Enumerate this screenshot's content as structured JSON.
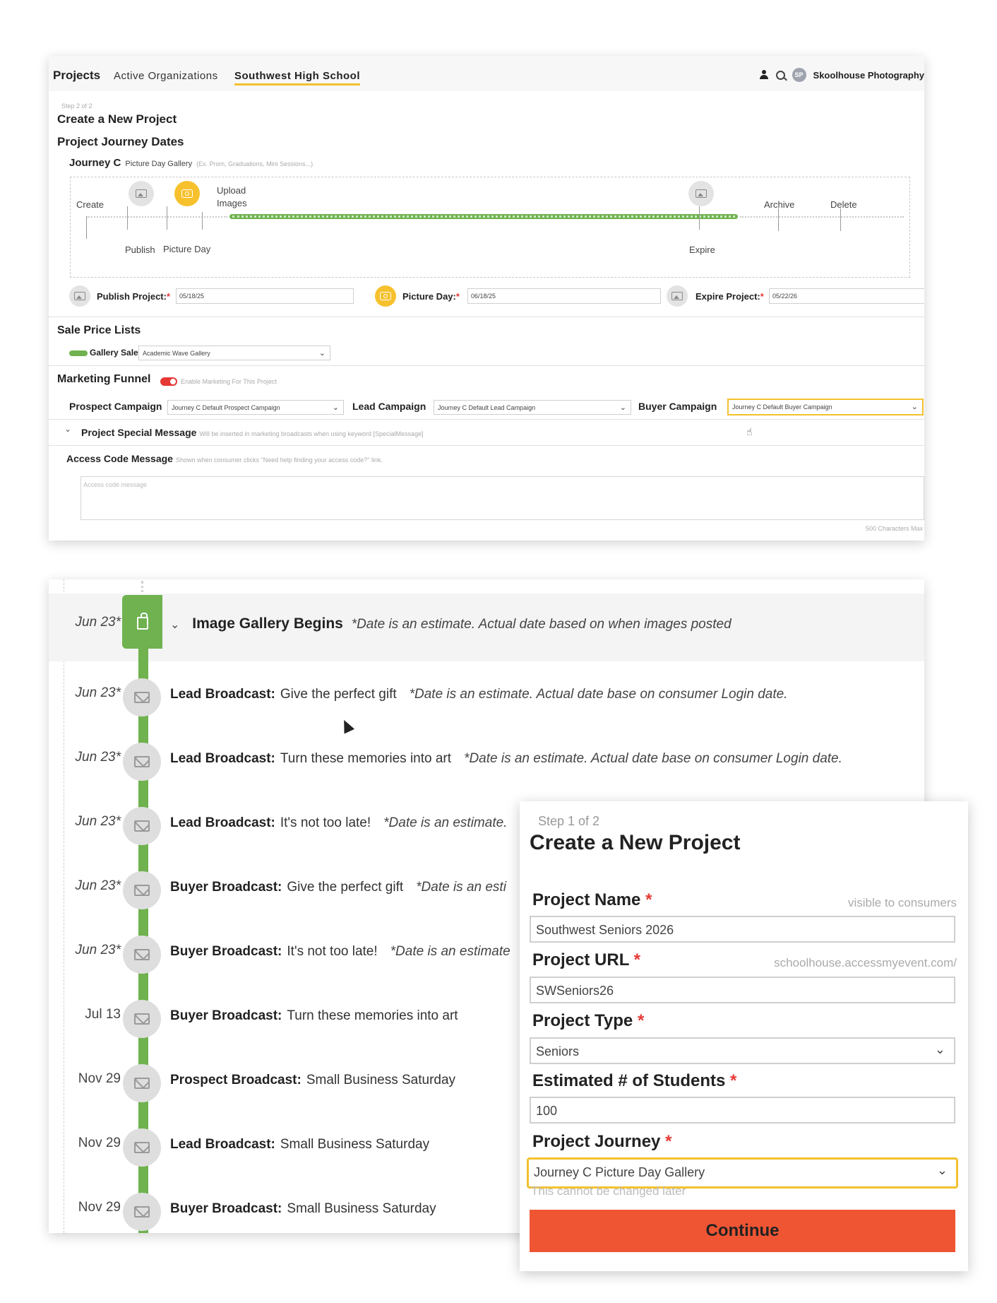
{
  "colors": {
    "accent_yellow": "#f2c12e",
    "timeline_green": "#6fb24f",
    "danger_red": "#e53935",
    "continue_orange": "#ef5533"
  },
  "nav": {
    "brand": "Projects",
    "items": [
      "Active Organizations",
      "Southwest High School"
    ],
    "active_item": "Southwest High School",
    "avatar_initials": "SP",
    "user_name": "Skoolhouse Photography",
    "icons": [
      "user-icon",
      "search-icon"
    ]
  },
  "create2": {
    "step": "Step 2 of 2",
    "title": "Create a New Project",
    "dates_heading": "Project Journey Dates",
    "journey_name": "Journey C",
    "journey_type": "Picture Day Gallery",
    "journey_hint": "(Ex. Prom, Graduations, Mini Sessions...)",
    "timeline": {
      "create": "Create",
      "publish": "Publish",
      "picture_day": "Picture Day",
      "upload_images_1": "Upload",
      "upload_images_2": "Images",
      "expire": "Expire",
      "archive": "Archive",
      "delete": "Delete"
    },
    "publish_label": "Publish Project:",
    "publish_value": "05/18/25",
    "picture_day_label": "Picture Day:",
    "picture_day_value": "06/18/25",
    "expire_label": "Expire Project:",
    "expire_value": "05/22/26",
    "required_mark": "*",
    "sale_heading": "Sale Price Lists",
    "gallery_sale_label": "Gallery Sale",
    "gallery_sale_value": "Academic Wave Gallery",
    "funnel_heading": "Marketing Funnel",
    "funnel_toggle_label": "Enable Marketing For This Project",
    "prospect_label": "Prospect Campaign",
    "prospect_value": "Journey C Default Prospect Campaign",
    "lead_label": "Lead Campaign",
    "lead_value": "Journey C Default Lead Campaign",
    "buyer_label": "Buyer Campaign",
    "buyer_value": "Journey C Default Buyer Campaign",
    "special_msg_label": "Project Special Message",
    "special_msg_hint": "Will be inserted in marketing broadcasts when using keyword [SpecialMessage]",
    "access_label": "Access Code Message",
    "access_hint": "Shown when consumer clicks \"Need help finding your access code?\" link.",
    "access_placeholder": "Access code message",
    "char_limit": "500 Characters Max"
  },
  "schedule": {
    "gallery_date": "Jun 23*",
    "gallery_title": "Image Gallery Begins",
    "gallery_note": "*Date is an estimate. Actual date based on when images posted",
    "events": [
      {
        "date": "Jun 23*",
        "kind": "Lead Broadcast:",
        "subject": "Give the perfect gift",
        "note": "*Date is an estimate. Actual date base on consumer Login date."
      },
      {
        "date": "Jun 23*",
        "kind": "Lead Broadcast:",
        "subject": "Turn these memories into art",
        "note": "*Date is an estimate. Actual date base on consumer Login date."
      },
      {
        "date": "Jun 23*",
        "kind": "Lead Broadcast:",
        "subject": "It's not too late!",
        "note": "*Date is an estimate."
      },
      {
        "date": "Jun 23*",
        "kind": "Buyer Broadcast:",
        "subject": "Give the perfect gift",
        "note": "*Date is an esti"
      },
      {
        "date": "Jun 23*",
        "kind": "Buyer Broadcast:",
        "subject": "It's not too late!",
        "note": "*Date is an estimate"
      },
      {
        "date": "Jul 13",
        "kind": "Buyer Broadcast:",
        "subject": "Turn these memories into art",
        "note": ""
      },
      {
        "date": "Nov 29",
        "kind": "Prospect Broadcast:",
        "subject": "Small Business Saturday",
        "note": ""
      },
      {
        "date": "Nov 29",
        "kind": "Lead Broadcast:",
        "subject": "Small Business Saturday",
        "note": ""
      },
      {
        "date": "Nov 29",
        "kind": "Buyer Broadcast:",
        "subject": "Small Business Saturday",
        "note": ""
      }
    ]
  },
  "create1": {
    "step": "Step 1 of 2",
    "title": "Create a New Project",
    "name_label": "Project Name",
    "name_hint": "visible to consumers",
    "name_value": "Southwest Seniors 2026",
    "url_label": "Project URL",
    "url_hint": "schoolhouse.accessmyevent.com/",
    "url_value": "SWSeniors26",
    "type_label": "Project Type",
    "type_value": "Seniors",
    "students_label": "Estimated # of Students",
    "students_value": "100",
    "journey_label": "Project Journey",
    "journey_value": "Journey C Picture Day Gallery",
    "journey_note": "This cannot be changed later",
    "continue_label": "Continue",
    "required_mark": "*"
  }
}
